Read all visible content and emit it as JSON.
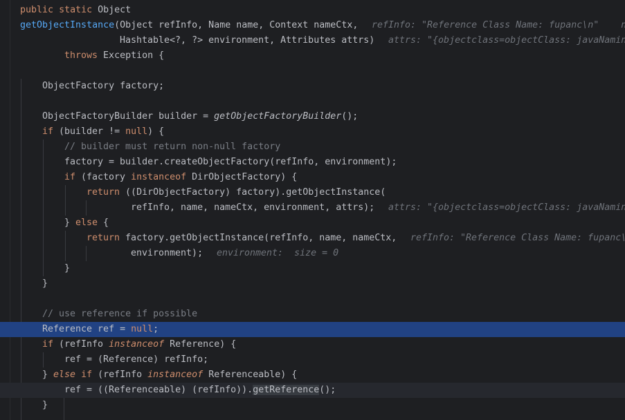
{
  "editor": {
    "language": "Java",
    "highlighted_line": "Reference ref = null;"
  },
  "lines": {
    "l1": [
      "public",
      " ",
      "static",
      " Object"
    ],
    "l2": [
      "getObjectInstance",
      "(Object refInfo, Name name, Context nameCtx,"
    ],
    "l2_hint": "refInfo: \"Reference Class Name: fupanc\\n\"    n",
    "l3": [
      "Hashtable<?, ?> environment, Attributes attrs)"
    ],
    "l3_hint": "attrs: \"{objectclass=objectClass: javaNaming",
    "l4": [
      "throws",
      " Exception {"
    ],
    "l6": [
      "ObjectFactory factory;"
    ],
    "l8": [
      "ObjectFactoryBuilder builder = ",
      "getObjectFactoryBuilder",
      "();"
    ],
    "l9": [
      "if",
      " (builder != ",
      "null",
      ") {"
    ],
    "l10": [
      "// builder must return non-null factory"
    ],
    "l11": [
      "factory = builder.createObjectFactory(refInfo, environment);"
    ],
    "l12": [
      "if",
      " (factory ",
      "instanceof",
      " DirObjectFactory) {"
    ],
    "l13": [
      "return",
      " ((DirObjectFactory) factory).getObjectInstance("
    ],
    "l14": [
      "refInfo, name, nameCtx, environment, attrs);"
    ],
    "l14_hint": "attrs: \"{objectclass=objectClass: javaNamin",
    "l15": [
      "} ",
      "else",
      " {"
    ],
    "l16": [
      "return",
      " factory.getObjectInstance(refInfo, name, nameCtx,"
    ],
    "l16_hint": "refInfo: \"Reference Class Name: fupanc\\",
    "l17": [
      "environment);"
    ],
    "l17_hint": "environment:  size = 0",
    "l18": [
      "}"
    ],
    "l19": [
      "}"
    ],
    "l21": [
      "// use reference if possible"
    ],
    "l22": [
      "Reference ref = ",
      "null",
      ";"
    ],
    "l23": [
      "if",
      " (refInfo ",
      "instanceof",
      " Reference) {"
    ],
    "l24": [
      "ref = (Reference) refInfo;"
    ],
    "l25": [
      "} ",
      "else",
      " ",
      "if",
      " (refInfo ",
      "instanceof",
      " Referenceable) {"
    ],
    "l26": [
      "ref = ((Referenceable) (refInfo)).",
      "getReference",
      "();"
    ],
    "l27": [
      "}"
    ]
  },
  "colors": {
    "background": "#1e1f22",
    "keyword": "#cf8e6d",
    "method_declaration": "#56a8f5",
    "comment": "#7a7e85",
    "inlay_hint": "#6f737a",
    "selection": "#214283"
  }
}
